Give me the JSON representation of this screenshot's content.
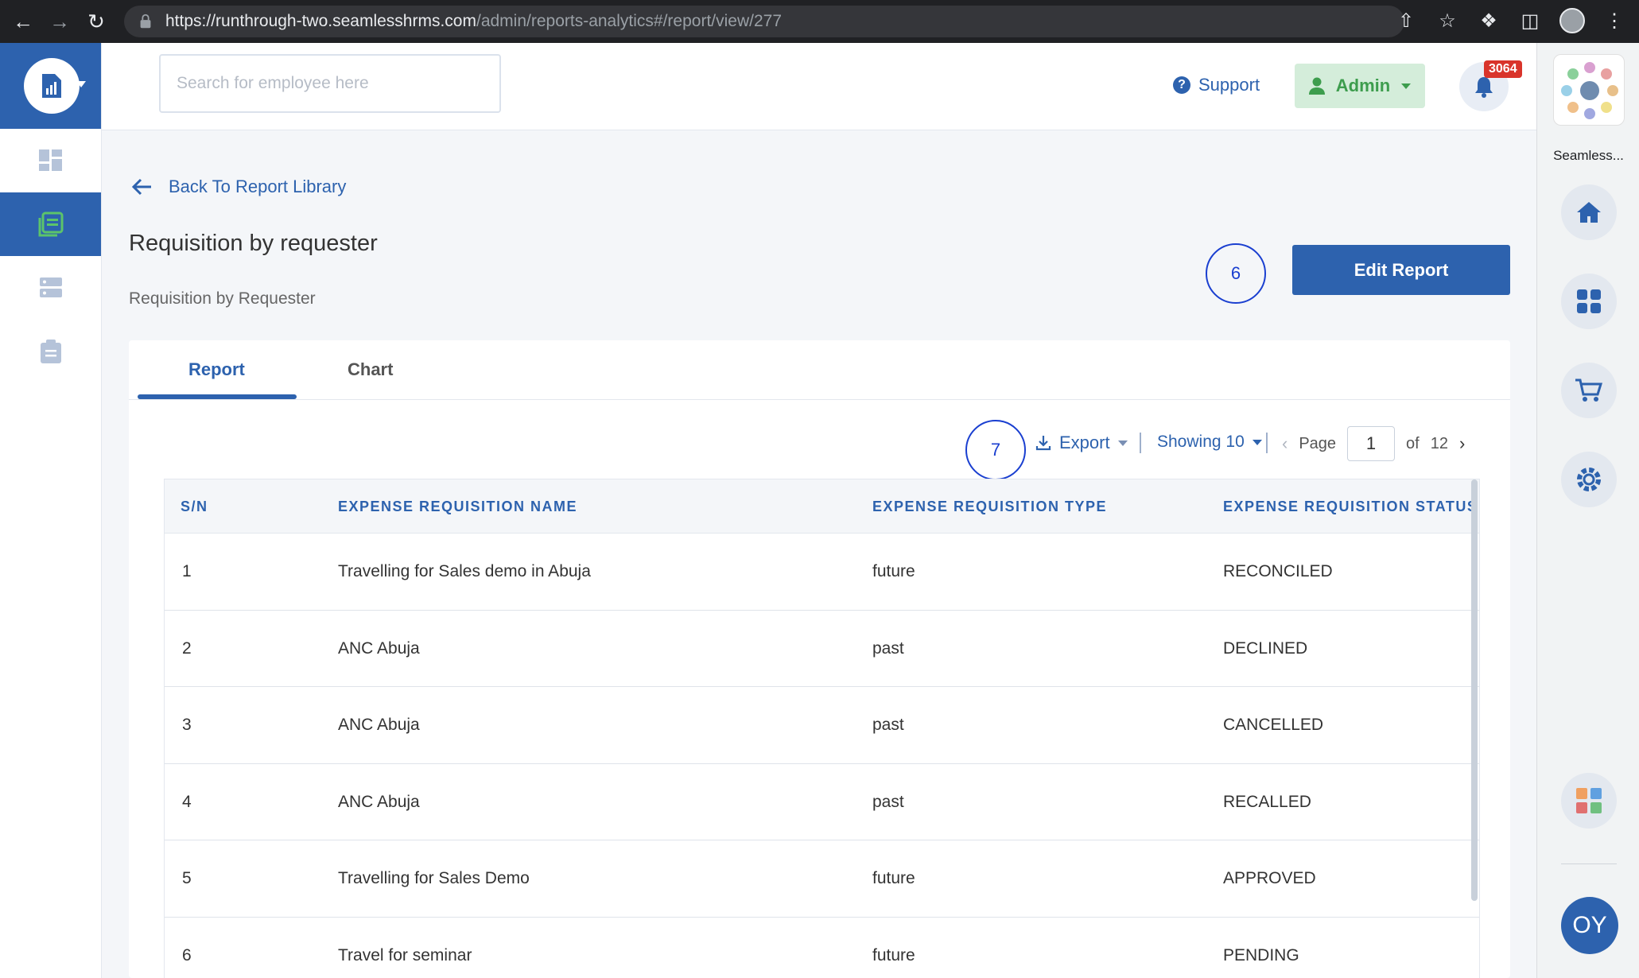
{
  "browser": {
    "url_host": "https://runthrough-two.seamlesshrms.com",
    "url_path": "/admin/reports-analytics#/report/view/277"
  },
  "header": {
    "search_placeholder": "Search for employee here",
    "support_label": "Support",
    "admin_label": "Admin",
    "notification_count": "3064"
  },
  "extension": {
    "label": "Seamless...",
    "user_initials": "OY"
  },
  "page": {
    "back_label": "Back To Report Library",
    "title": "Requisition by requester",
    "subtitle": "Requisition by Requester",
    "edit_button": "Edit Report",
    "annotation_6": "6",
    "annotation_7": "7"
  },
  "tabs": [
    {
      "label": "Report",
      "active": true
    },
    {
      "label": "Chart",
      "active": false
    }
  ],
  "toolbar": {
    "export_label": "Export",
    "showing_label": "Showing 10",
    "page_label": "Page",
    "page_value": "1",
    "of_label": "of",
    "total_pages": "12"
  },
  "table": {
    "headers": [
      "S/N",
      "EXPENSE REQUISITION NAME",
      "EXPENSE REQUISITION TYPE",
      "EXPENSE REQUISITION STATUS"
    ],
    "rows": [
      [
        "1",
        "Travelling for Sales demo in Abuja",
        "future",
        "RECONCILED"
      ],
      [
        "2",
        "ANC Abuja",
        "past",
        "DECLINED"
      ],
      [
        "3",
        "ANC Abuja",
        "past",
        "CANCELLED"
      ],
      [
        "4",
        "ANC Abuja",
        "past",
        "RECALLED"
      ],
      [
        "5",
        "Travelling for Sales Demo",
        "future",
        "APPROVED"
      ],
      [
        "6",
        "Travel for seminar",
        "future",
        "PENDING"
      ]
    ]
  },
  "colors": {
    "primary": "#2d62ae",
    "admin_bg": "#d4edda",
    "admin_text": "#3d9d4d",
    "badge": "#d9342b",
    "annotation": "#1a3fd0"
  }
}
